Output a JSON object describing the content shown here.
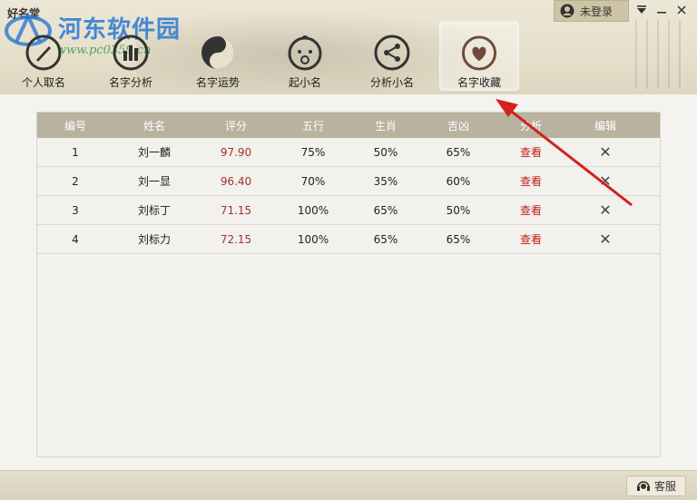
{
  "app": {
    "title": "好名堂"
  },
  "watermark": {
    "site_name": "河东软件园",
    "url": "www.pc0359.cn"
  },
  "header": {
    "login_label": "未登录",
    "login_icon": "user-icon",
    "window_controls": [
      "dropdown",
      "minimize",
      "close"
    ]
  },
  "nav": {
    "items": [
      {
        "label": "个人取名",
        "icon": "pen-icon"
      },
      {
        "label": "名字分析",
        "icon": "bar-chart-icon"
      },
      {
        "label": "名字运势",
        "icon": "yin-yang-icon"
      },
      {
        "label": "起小名",
        "icon": "baby-icon"
      },
      {
        "label": "分析小名",
        "icon": "share-icon"
      },
      {
        "label": "名字收藏",
        "icon": "heart-icon"
      }
    ],
    "active_index": 5
  },
  "table": {
    "headers": [
      "编号",
      "姓名",
      "评分",
      "五行",
      "生肖",
      "吉凶",
      "分析",
      "编辑"
    ],
    "rows": [
      {
        "id": "1",
        "name": "刘一麟",
        "score": "97.90",
        "wuxing": "75%",
        "shengxiao": "50%",
        "jixiong": "65%",
        "analysis": "查看",
        "edit": "✕"
      },
      {
        "id": "2",
        "name": "刘一显",
        "score": "96.40",
        "wuxing": "70%",
        "shengxiao": "35%",
        "jixiong": "60%",
        "analysis": "查看",
        "edit": "✕"
      },
      {
        "id": "3",
        "name": "刘标丁",
        "score": "71.15",
        "wuxing": "100%",
        "shengxiao": "65%",
        "jixiong": "50%",
        "analysis": "查看",
        "edit": "✕"
      },
      {
        "id": "4",
        "name": "刘标力",
        "score": "72.15",
        "wuxing": "100%",
        "shengxiao": "65%",
        "jixiong": "65%",
        "analysis": "查看",
        "edit": "✕"
      }
    ]
  },
  "footer": {
    "service_label": "客服",
    "service_icon": "headset-icon"
  },
  "colors": {
    "accent_red": "#c0201c",
    "score_red": "#a3312d",
    "header_bg": "#b8b29f",
    "annotation_arrow": "#d42020"
  }
}
